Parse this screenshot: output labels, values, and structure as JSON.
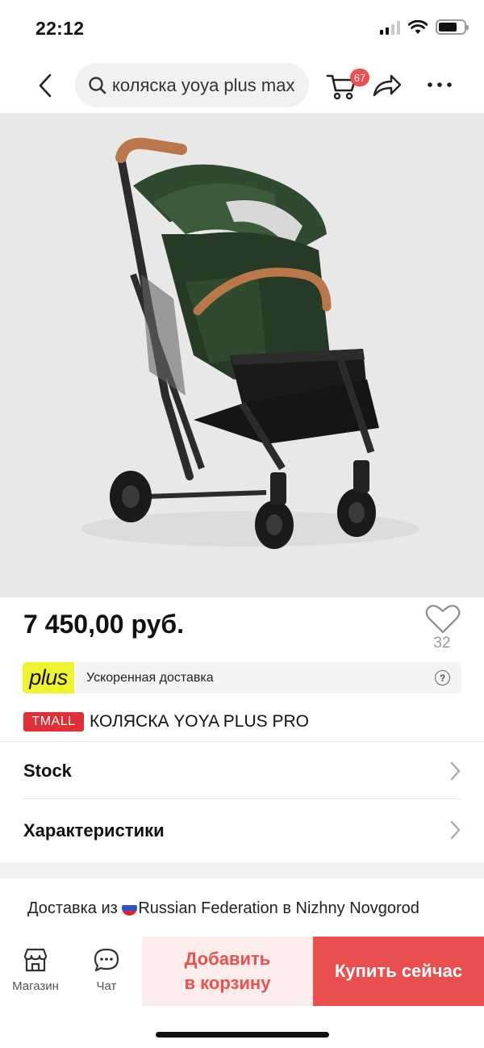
{
  "status_bar": {
    "time": "22:12"
  },
  "header": {
    "search_value": "коляска yoya plus max",
    "cart_badge_count": "67"
  },
  "product": {
    "price": "7 450,00 руб.",
    "favorites_count": "32",
    "plus_logo": "plus",
    "plus_text": "Ускоренная доставка",
    "tmall_badge": "TMALL",
    "title": "КОЛЯСКА YOYA PLUS PRO",
    "image_colors": {
      "background": "#e8e8e8",
      "canopy": "#2f4a2e",
      "frame": "#2b2b2b",
      "handle": "#b9774a"
    }
  },
  "rows": {
    "stock_label": "Stock",
    "specs_label": "Характеристики"
  },
  "delivery": {
    "prefix": "Доставка из ",
    "text": "Russian Federation в Nizhny Novgorod"
  },
  "bottom_bar": {
    "shop_label": "Магазин",
    "chat_label": "Чат",
    "add_to_cart_line1": "Добавить",
    "add_to_cart_line2": "в корзину",
    "buy_now_label": "Купить сейчас"
  },
  "colors": {
    "accent_red": "#ea4f4f",
    "add_cart_bg": "#fdecec",
    "plus_yellow": "#eef330",
    "tmall_red": "#e02f36"
  },
  "icons": [
    "back-icon",
    "search-icon",
    "cart-icon",
    "share-icon",
    "more-icon",
    "heart-icon",
    "help-icon",
    "chevron-right-icon",
    "shop-icon",
    "chat-icon"
  ]
}
